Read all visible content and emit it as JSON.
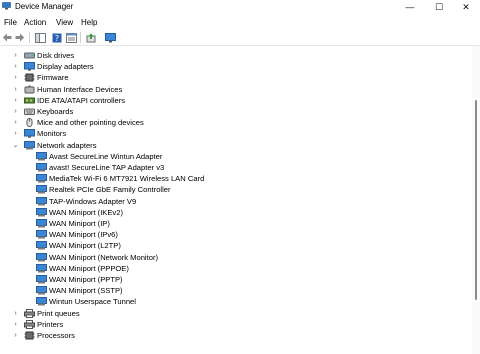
{
  "window": {
    "title": "Device Manager",
    "minimize": "—",
    "maximize": "☐",
    "close": "✕"
  },
  "menu": {
    "file": "File",
    "action": "Action",
    "view": "View",
    "help": "Help"
  },
  "tree": {
    "categories": [
      {
        "label": "Disk drives",
        "icon": "disk-icon",
        "expanded": false
      },
      {
        "label": "Display adapters",
        "icon": "display-icon",
        "expanded": false
      },
      {
        "label": "Firmware",
        "icon": "chip-icon",
        "expanded": false
      },
      {
        "label": "Human Interface Devices",
        "icon": "hid-icon",
        "expanded": false
      },
      {
        "label": "IDE ATA/ATAPI controllers",
        "icon": "controller-icon",
        "expanded": false
      },
      {
        "label": "Keyboards",
        "icon": "keyboard-icon",
        "expanded": false
      },
      {
        "label": "Mice and other pointing devices",
        "icon": "mouse-icon",
        "expanded": false
      },
      {
        "label": "Monitors",
        "icon": "monitor-icon",
        "expanded": false
      },
      {
        "label": "Network adapters",
        "icon": "network-icon",
        "expanded": true
      }
    ],
    "network_adapters": [
      "Avast SecureLine Wintun Adapter",
      "avast! SecureLine TAP Adapter v3",
      "MediaTek Wi-Fi 6 MT7921 Wireless LAN Card",
      "Realtek PCIe GbE Family Controller",
      "TAP-Windows Adapter V9",
      "WAN Miniport (IKEv2)",
      "WAN Miniport (IP)",
      "WAN Miniport (IPv6)",
      "WAN Miniport (L2TP)",
      "WAN Miniport (Network Monitor)",
      "WAN Miniport (PPPOE)",
      "WAN Miniport (PPTP)",
      "WAN Miniport (SSTP)",
      "Wintun Userspace Tunnel"
    ],
    "after": [
      {
        "label": "Print queues",
        "icon": "printer-icon",
        "expanded": false
      },
      {
        "label": "Printers",
        "icon": "printer-icon",
        "expanded": false
      },
      {
        "label": "Processors",
        "icon": "chip-icon",
        "expanded": false
      }
    ]
  }
}
